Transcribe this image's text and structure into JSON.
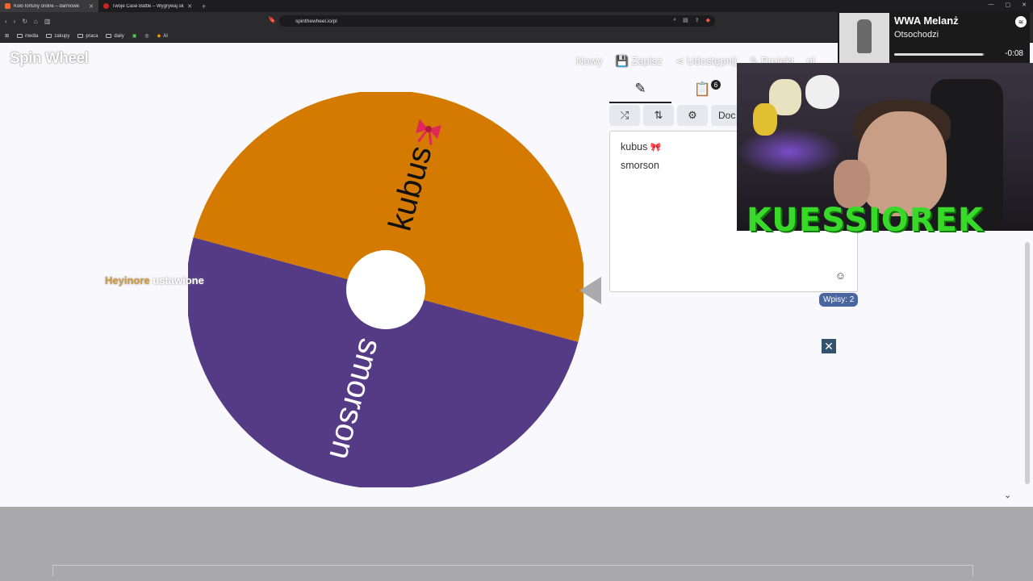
{
  "browser": {
    "tabs": [
      {
        "title": "Koło fortuny online – darmowe",
        "active": true
      },
      {
        "title": "Twoje Case Battle – Wygrywaj skiny",
        "active": false
      }
    ],
    "new_tab": "+",
    "url": "spinthewheel.io/pl",
    "bookmarks": [
      "media",
      "zakupy",
      "praca",
      "daily",
      "AI"
    ]
  },
  "app": {
    "logo": "Spin Wheel",
    "menu": {
      "new": "Nowy",
      "save": "Zapisz",
      "share": "Udostępnij",
      "project": "Projekt",
      "lang": "pl"
    }
  },
  "wheel": {
    "segments": [
      {
        "label": "kubus",
        "color": "#d47a00"
      },
      {
        "label": "smorson",
        "color": "#553b85"
      }
    ]
  },
  "overlay_text": {
    "part1": "Heyinore",
    "part2": "ustawione"
  },
  "editor": {
    "entries_badge": "6",
    "tool_doc": "Doc",
    "entries": [
      "kubus",
      "smorson"
    ],
    "count_label": "Wpisy: 2"
  },
  "spotify": {
    "title": "WWA Melanż",
    "artist": "Otsochodzi",
    "time": "-0:08",
    "progress": 0.98
  },
  "stream": {
    "name": "KUESSIOREK"
  }
}
